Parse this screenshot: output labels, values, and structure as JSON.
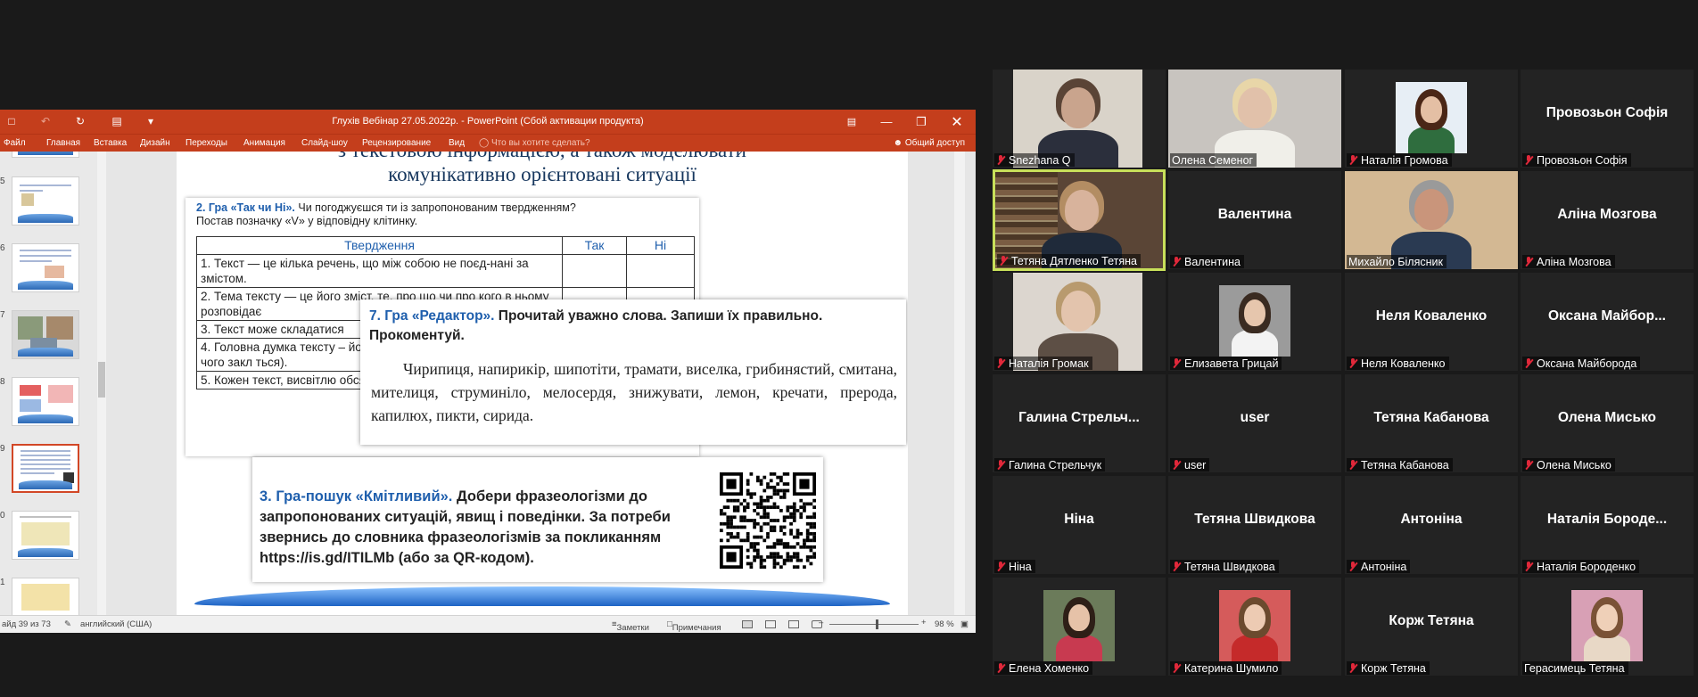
{
  "powerpoint": {
    "window_title": "Глухів Вебінар 27.05.2022р. - PowerPoint (Сбой активации продукта)",
    "ribbon_tabs": [
      "Файл",
      "Главная",
      "Вставка",
      "Дизайн",
      "Переходы",
      "Анимация",
      "Слайд-шоу",
      "Рецензирование",
      "Вид"
    ],
    "tell_me": "Что вы хотите сделать?",
    "share": "Общий доступ",
    "thumbnails": [
      {
        "num": "5"
      },
      {
        "num": "6"
      },
      {
        "num": "7"
      },
      {
        "num": "8"
      },
      {
        "num": "9"
      },
      {
        "num": "0"
      },
      {
        "num": "1"
      }
    ],
    "active_thumbnail": "9",
    "status": {
      "slide_of": "айд 39 из 73",
      "language": "английский (США)",
      "notes": "Заметки",
      "comments": "Примечания",
      "zoom": "98 %"
    }
  },
  "slide": {
    "heading_line1": "з текстовою інформацією, а також моделювати",
    "heading_line2": "комунікативно орієнтовані ситуації",
    "task2": {
      "title": "2. Гра «Так чи Ні».",
      "text": "Чи погоджуєшся ти із запропонованим твердженням?",
      "text2": "Постав позначку «V» у відповідну клітинку.",
      "headers": [
        "Твердження",
        "Так",
        "Ні"
      ],
      "rows": [
        "1. Текст — це кілька речень, що між собою не поєд-нані за змістом.",
        "2. Тема тексту — це його зміст, те, про що чи про кого в ньому розповідає",
        "3. Текст може складатися",
        "4. Головна думка тексту – його було створено (щ оспівує, до чого закл ться).",
        "5. Кожен текст, висвітлю обсяг фактів, певну інф"
      ]
    },
    "task7": {
      "title": "7. Гра «Редактор».",
      "text": "Прочитай уважно слова. Запиши їх правильно. Прокоментуй.",
      "words": "Чирипиця, напирикір, шипотіти, трамати, виселка, грибинястий, смитана, мителиця, струминіло, мелосердя, знижувати, лемон, кречати, прерода, капилюх, пикти, сирида."
    },
    "task3": {
      "title": "3. Гра-пошук «Кмітливий».",
      "text": "Добери фразеологізми до запропонованих ситуацій, явищ і поведінки. За потреби звернись до словника фразеологізмів за покликанням  https://is.gd/ITILMb (або за QR-кодом)."
    }
  },
  "participants": [
    {
      "label": "Snezhana Q",
      "muted": true,
      "kind": "video"
    },
    {
      "label": "Олена Семеног",
      "muted": false,
      "kind": "video"
    },
    {
      "label": "Наталія Громова",
      "muted": true,
      "kind": "photo"
    },
    {
      "label": "Провозьон Софія",
      "muted": true,
      "kind": "name",
      "display": "Провозьон Софія"
    },
    {
      "label": "Тетяна Дятленко Тетяна",
      "muted": true,
      "kind": "video",
      "speaking": true
    },
    {
      "label": "Валентина",
      "muted": true,
      "kind": "name",
      "display": "Валентина"
    },
    {
      "label": "Михайло Білясник",
      "muted": false,
      "kind": "video"
    },
    {
      "label": "Аліна Мозгова",
      "muted": true,
      "kind": "name",
      "display": "Аліна Мозгова"
    },
    {
      "label": "Наталія Громак",
      "muted": true,
      "kind": "video"
    },
    {
      "label": "Елизавета Грицай",
      "muted": true,
      "kind": "photo"
    },
    {
      "label": "Неля Коваленко",
      "muted": true,
      "kind": "name",
      "display": "Неля Коваленко"
    },
    {
      "label": "Оксана Майборода",
      "muted": true,
      "kind": "name",
      "display": "Оксана  Майбор..."
    },
    {
      "label": "Галина Стрельчук",
      "muted": true,
      "kind": "name",
      "display": "Галина  Стрельч..."
    },
    {
      "label": "user",
      "muted": true,
      "kind": "name",
      "display": "user"
    },
    {
      "label": "Тетяна Кабанова",
      "muted": true,
      "kind": "name",
      "display": "Тетяна Кабанова"
    },
    {
      "label": "Олена Мисько",
      "muted": true,
      "kind": "name",
      "display": "Олена Мисько"
    },
    {
      "label": "Ніна",
      "muted": true,
      "kind": "name",
      "display": "Ніна"
    },
    {
      "label": "Тетяна Швидкова",
      "muted": true,
      "kind": "name",
      "display": "Тетяна Швидкова"
    },
    {
      "label": "Антоніна",
      "muted": true,
      "kind": "name",
      "display": "Антоніна"
    },
    {
      "label": "Наталія Бороденко",
      "muted": true,
      "kind": "name",
      "display": "Наталія  Бороде..."
    },
    {
      "label": "Елена Хоменко",
      "muted": true,
      "kind": "photo"
    },
    {
      "label": "Катерина Шумило",
      "muted": true,
      "kind": "photo"
    },
    {
      "label": "Корж Тетяна",
      "muted": true,
      "kind": "name",
      "display": "Корж Тетяна"
    },
    {
      "label": "Герасимець Тетяна",
      "muted": false,
      "kind": "photo"
    }
  ],
  "colors": {
    "ppt_accent": "#c43e1c",
    "speaking_border": "#c8e05a",
    "muted_mic": "#e0283a",
    "slide_blue": "#1f5fad"
  }
}
